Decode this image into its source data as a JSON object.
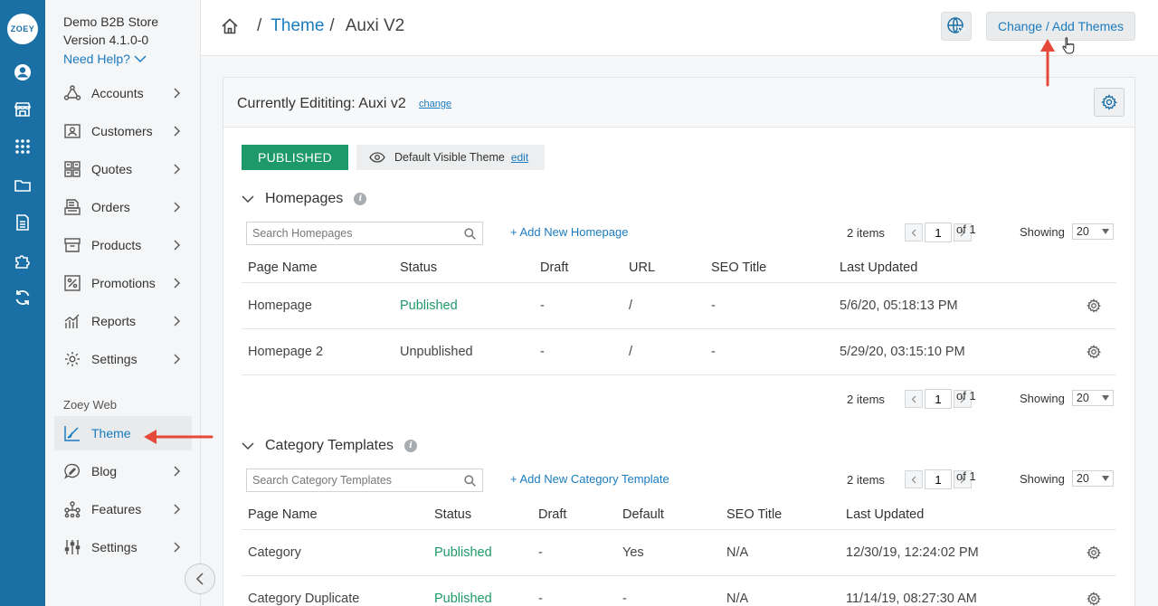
{
  "app": {
    "logo_text": "ZOEY",
    "store_name": "Demo B2B Store",
    "version": "Version 4.1.0-0",
    "need_help": "Need Help?"
  },
  "sidebar": {
    "items": [
      {
        "label": "Accounts",
        "icon": "accounts-icon"
      },
      {
        "label": "Customers",
        "icon": "customers-icon"
      },
      {
        "label": "Quotes",
        "icon": "quotes-icon"
      },
      {
        "label": "Orders",
        "icon": "orders-icon"
      },
      {
        "label": "Products",
        "icon": "products-icon"
      },
      {
        "label": "Promotions",
        "icon": "promotions-icon"
      },
      {
        "label": "Reports",
        "icon": "reports-icon"
      },
      {
        "label": "Settings",
        "icon": "gear-icon"
      }
    ],
    "section_label": "Zoey Web",
    "web_items": [
      {
        "label": "Theme",
        "icon": "theme-icon",
        "active": true
      },
      {
        "label": "Blog",
        "icon": "blog-icon"
      },
      {
        "label": "Features",
        "icon": "features-icon"
      },
      {
        "label": "Settings",
        "icon": "sliders-icon"
      }
    ]
  },
  "rail": {
    "icons": [
      "account-circle-icon",
      "store-icon",
      "apps-grid-icon",
      "folder-icon",
      "document-icon",
      "puzzle-icon",
      "refresh-icon"
    ]
  },
  "header": {
    "breadcrumb": {
      "link": "Theme",
      "sep": "/",
      "current": "Auxi V2"
    },
    "globe_icon": "globe-cursor-icon",
    "change_button": "Change / Add Themes"
  },
  "panel": {
    "title": "Currently Edititing: Auxi v2",
    "change_link": "change",
    "published_badge": "PUBLISHED",
    "visible_theme": "Default Visible Theme",
    "edit_link": "edit"
  },
  "homepages": {
    "title": "Homepages",
    "info": "i",
    "search_placeholder": "Search Homepages",
    "add_link": "+ Add New Homepage",
    "pager": {
      "items": "2 items",
      "page": "1",
      "of": "of 1",
      "showing": "Showing",
      "per_page": "20"
    },
    "columns": [
      "Page Name",
      "Status",
      "Draft",
      "URL",
      "SEO Title",
      "Last Updated"
    ],
    "rows": [
      {
        "name": "Homepage",
        "status": "Published",
        "draft": "-",
        "url": "/",
        "seo": "-",
        "updated": "5/6/20, 05:18:13 PM"
      },
      {
        "name": "Homepage 2",
        "status": "Unpublished",
        "draft": "-",
        "url": "/",
        "seo": "-",
        "updated": "5/29/20, 03:15:10 PM"
      }
    ]
  },
  "category_templates": {
    "title": "Category Templates",
    "info": "i",
    "search_placeholder": "Search Category Templates",
    "add_link": "+ Add New Category Template",
    "pager": {
      "items": "2 items",
      "page": "1",
      "of": "of 1",
      "showing": "Showing",
      "per_page": "20"
    },
    "columns": [
      "Page Name",
      "Status",
      "Draft",
      "Default",
      "SEO Title",
      "Last Updated"
    ],
    "rows": [
      {
        "name": "Category",
        "status": "Published",
        "draft": "-",
        "default": "Yes",
        "seo": "N/A",
        "updated": "12/30/19, 12:24:02 PM"
      },
      {
        "name": "Category Duplicate",
        "status": "Published",
        "draft": "-",
        "default": "-",
        "seo": "N/A",
        "updated": "11/14/19, 08:27:30 AM"
      }
    ]
  },
  "colors": {
    "rail": "#1a6fa5",
    "link": "#1a7bbf",
    "published": "#1e9a6a",
    "annotation_arrow": "#e5493a"
  }
}
